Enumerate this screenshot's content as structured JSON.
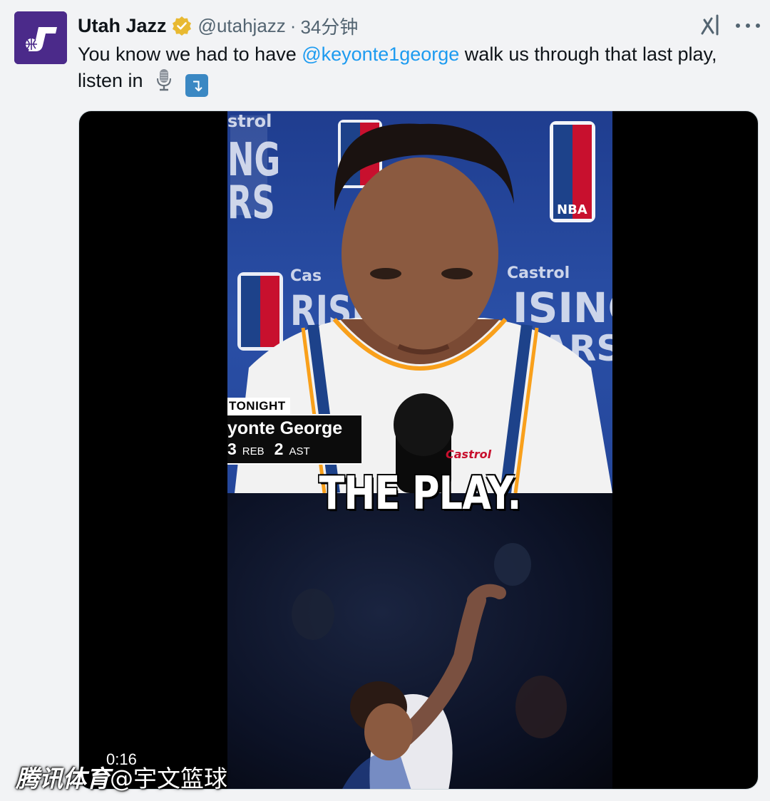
{
  "author": {
    "display_name": "Utah Jazz",
    "handle": "@utahjazz",
    "separator": "·",
    "time": "34分钟",
    "avatar_icon": "utah-jazz-logo-icon",
    "avatar_color": "#4b2a8a",
    "verified_color": "#e8b931"
  },
  "tweet": {
    "text_before": "You know we had to have ",
    "mention": "@keyonte1george",
    "text_after": " walk us through that last play, listen in",
    "emoji_1": "microphone-icon",
    "emoji_2": "↴",
    "mention_color": "#1d9bf0"
  },
  "actions": {
    "grok_icon": "grok-icon",
    "more_icon": "more-icon"
  },
  "video": {
    "lower_third_tag": "TONIGHT",
    "player_name": "yonte George",
    "stat_1_value": "3",
    "stat_1_label": "REB",
    "stat_2_value": "2",
    "stat_2_label": "AST",
    "caption": "THE PLAY.",
    "timestamp": "0:16"
  },
  "watermark": {
    "brand": "腾讯体育",
    "author": "@宇文篮球"
  }
}
